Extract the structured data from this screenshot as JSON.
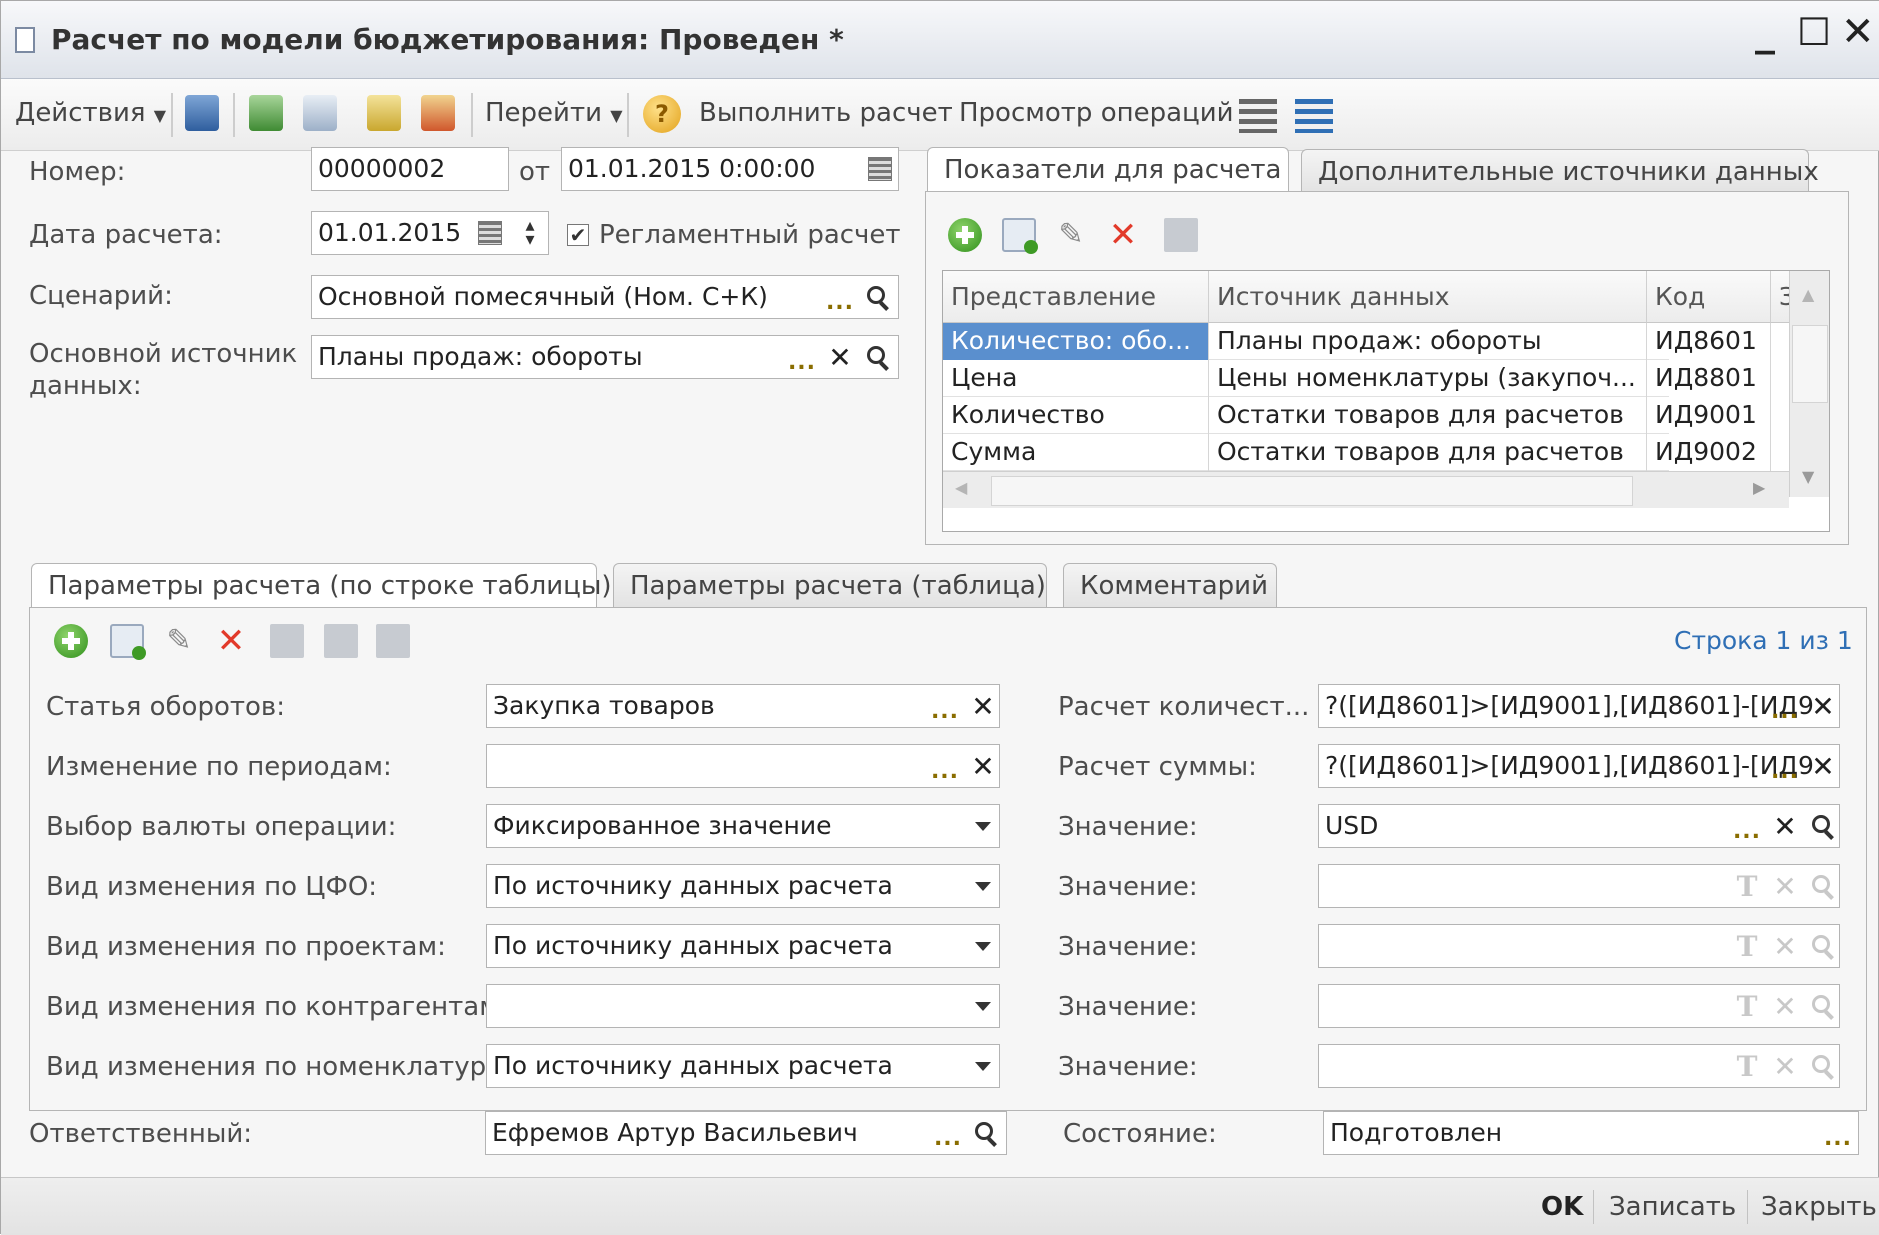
{
  "window": {
    "title": "Расчет по модели бюджетирования: Проведен *",
    "minimize": "_",
    "maximize": "☐",
    "close": "✕"
  },
  "toolbar": {
    "actions": "Действия",
    "goto": "Перейти",
    "run_calc": "Выполнить расчет",
    "view_ops": "Просмотр операций",
    "help": "?"
  },
  "header": {
    "number_label": "Номер:",
    "number_value": "00000002",
    "from_label": "от",
    "from_value": "01.01.2015 0:00:00",
    "calc_date_label": "Дата расчета:",
    "calc_date_value": "01.01.2015",
    "reglament_label": "Регламентный расчет",
    "reglament_checked": true,
    "scenario_label": "Сценарий:",
    "scenario_value": "Основной помесячный (Ном. С+К)",
    "source_label_line1": "Основной источник",
    "source_label_line2": "данных:",
    "source_value": "Планы продаж: обороты"
  },
  "top_tabs": [
    {
      "label": "Показатели для расчета",
      "active": true
    },
    {
      "label": "Дополнительные источники данных",
      "active": false
    }
  ],
  "indicators_table": {
    "columns": [
      "Представление",
      "Источник данных",
      "Код",
      "Зн"
    ],
    "rows": [
      {
        "repr": "Количество: обо...",
        "source": "Планы продаж: обороты",
        "code": "ИД8601",
        "selected": true
      },
      {
        "repr": "Цена",
        "source": "Цены номенклатуры (закупоч...",
        "code": "ИД8801",
        "selected": false
      },
      {
        "repr": "Количество",
        "source": "Остатки товаров для расчетов",
        "code": "ИД9001",
        "selected": false
      },
      {
        "repr": "Сумма",
        "source": "Остатки товаров для расчетов",
        "code": "ИД9002",
        "selected": false
      }
    ]
  },
  "bottom_tabs": [
    {
      "label": "Параметры расчета (по строке таблицы)",
      "active": true
    },
    {
      "label": "Параметры расчета (таблица)",
      "active": false
    },
    {
      "label": "Комментарий",
      "active": false
    }
  ],
  "row_counter": "Строка 1 из 1",
  "params_left": [
    {
      "label": "Статья оборотов:",
      "value": "Закупка товаров",
      "kind": "choice-clear"
    },
    {
      "label": "Изменение по периодам:",
      "value": "",
      "kind": "choice-clear"
    },
    {
      "label": "Выбор валюты операции:",
      "value": "Фиксированное значение",
      "kind": "dropdown"
    },
    {
      "label": "Вид изменения по ЦФО:",
      "value": "По источнику данных расчета",
      "kind": "dropdown"
    },
    {
      "label": "Вид изменения по проектам:",
      "value": "По источнику данных расчета",
      "kind": "dropdown"
    },
    {
      "label": "Вид изменения по контрагентам:",
      "value": "",
      "kind": "dropdown"
    },
    {
      "label": "Вид изменения по номенклатуре:",
      "value": "По источнику данных расчета",
      "kind": "dropdown"
    }
  ],
  "params_right": [
    {
      "label": "Расчет количест...",
      "value": "?([ИД8601]>[ИД9001],[ИД8601]-[ИД9"
    },
    {
      "label": "Расчет суммы:",
      "value": "?([ИД8601]>[ИД9001],[ИД8601]-[ИД9"
    },
    {
      "label": "Значение:",
      "value": "USD"
    },
    {
      "label": "Значение:",
      "value": ""
    },
    {
      "label": "Значение:",
      "value": ""
    },
    {
      "label": "Значение:",
      "value": ""
    },
    {
      "label": "Значение:",
      "value": ""
    }
  ],
  "responsible": {
    "label": "Ответственный:",
    "value": "Ефремов Артур Васильевич"
  },
  "state": {
    "label": "Состояние:",
    "value": "Подготовлен"
  },
  "footer": {
    "ok": "OK",
    "save": "Записать",
    "close": "Закрыть"
  },
  "colors": {
    "selection": "#5a8fce",
    "link": "#2f6fb5",
    "delete": "#e23a2a",
    "add": "#2f8f1b"
  }
}
